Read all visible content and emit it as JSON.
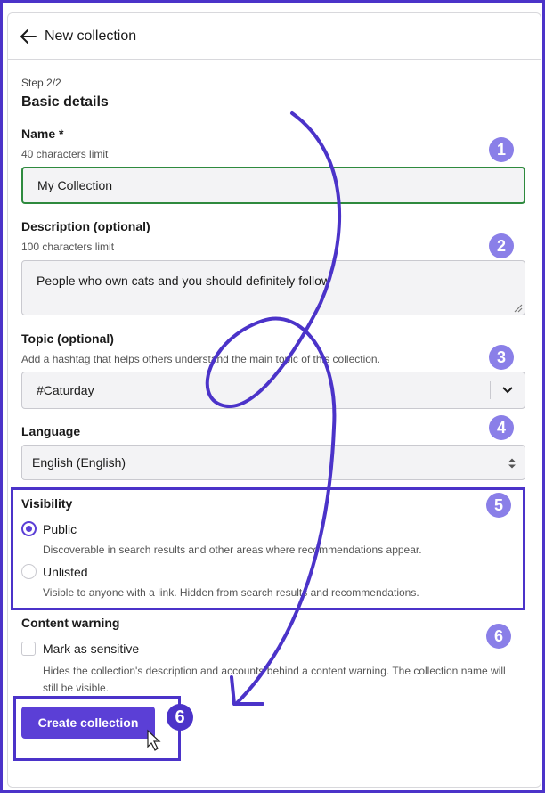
{
  "header": {
    "title": "New collection"
  },
  "form": {
    "step": "Step 2/2",
    "section_title": "Basic details",
    "name": {
      "label": "Name *",
      "hint": "40 characters limit",
      "value": "My Collection"
    },
    "description": {
      "label": "Description (optional)",
      "hint": "100 characters limit",
      "value": "People who own cats and you should definitely follow"
    },
    "topic": {
      "label": "Topic (optional)",
      "hint": "Add a hashtag that helps others understand the main topic of this collection.",
      "value": "#Caturday"
    },
    "language": {
      "label": "Language",
      "value": "English (English)"
    },
    "visibility": {
      "label": "Visibility",
      "options": [
        {
          "label": "Public",
          "description": "Discoverable in search results and other areas where recommendations appear.",
          "selected": true
        },
        {
          "label": "Unlisted",
          "description": "Visible to anyone with a link. Hidden from search results and recommendations.",
          "selected": false
        }
      ]
    },
    "content_warning": {
      "label": "Content warning",
      "checkbox_label": "Mark as sensitive",
      "description": "Hides the collection's description and accounts behind a content warning. The collection name will still be visible."
    },
    "submit_label": "Create collection"
  },
  "annotations": {
    "badges": [
      "1",
      "2",
      "3",
      "4",
      "5",
      "6",
      "6"
    ],
    "accent_color": "#4b33c9",
    "badge_color": "#8a7fe8"
  },
  "colors": {
    "primary": "#5b3fd6",
    "valid_border": "#2e8a3e"
  }
}
